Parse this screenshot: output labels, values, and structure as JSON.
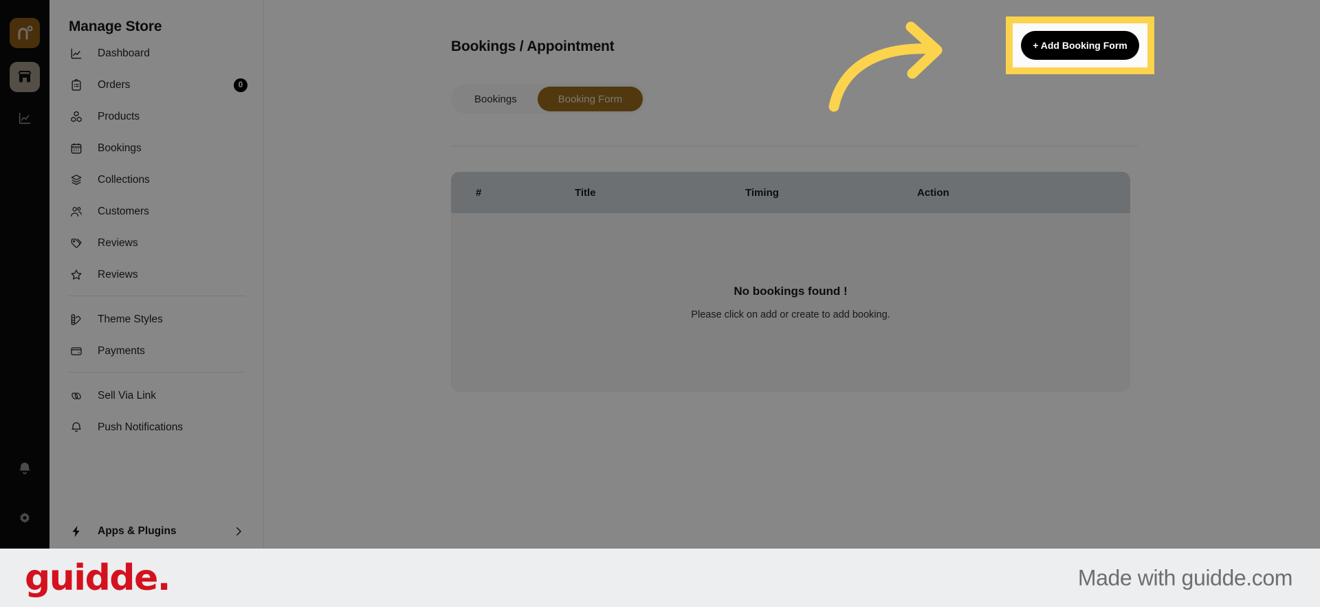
{
  "app": {
    "rail": {
      "logo_icon": "nuvemshop-n-logo-icon",
      "items": [
        {
          "icon": "store-icon",
          "name": "store",
          "active": true
        },
        {
          "icon": "analytics-chart-icon",
          "name": "analytics",
          "active": false
        },
        {
          "icon": "bell-icon",
          "name": "notifications",
          "active": false
        },
        {
          "icon": "gear-icon",
          "name": "settings",
          "active": false
        }
      ]
    },
    "sidebar": {
      "title": "Manage Store",
      "items": [
        {
          "label": "Dashboard",
          "icon": "chart-line-icon",
          "badge": null
        },
        {
          "label": "Orders",
          "icon": "clipboard-list-icon",
          "badge": "0"
        },
        {
          "label": "Products",
          "icon": "boxes-cubes-icon",
          "badge": null
        },
        {
          "label": "Bookings",
          "icon": "calendar-icon",
          "badge": null
        },
        {
          "label": "Collections",
          "icon": "layers-icon",
          "badge": null
        },
        {
          "label": "Customers",
          "icon": "users-icon",
          "badge": null
        },
        {
          "label": "Reviews",
          "icon": "star-icon",
          "badge": null
        },
        {
          "label": "Theme Styles",
          "icon": "palette-swatch-icon",
          "badge": null
        },
        {
          "label": "Payments",
          "icon": "wallet-icon",
          "badge": null
        },
        {
          "label": "Sell Via Link",
          "icon": "link-chain-icon",
          "badge": null
        },
        {
          "label": "Push Notifications",
          "icon": "bell-outline-icon",
          "badge": null
        }
      ],
      "footer": {
        "label": "Apps & Plugins",
        "icon": "lightning-bolt-icon",
        "chevron": "chevron-right-icon"
      }
    },
    "main": {
      "page_title": "Bookings / Appointment",
      "tabs": [
        {
          "label": "Bookings",
          "active": false
        },
        {
          "label": "Booking Form",
          "active": true
        }
      ],
      "cta": {
        "label": "+ Add Booking Form",
        "highlight_color": "#fcd34d",
        "background": "#000000"
      },
      "table": {
        "columns": [
          "#",
          "Title",
          "Timing",
          "Action"
        ],
        "rows": [],
        "empty_title": "No bookings found !",
        "empty_subtitle": "Please click on add or create to add booking."
      }
    },
    "footer": {
      "logo_text": "guidde.",
      "logo_color": "#d4111e",
      "made_with": "Made with guidde.com"
    },
    "annotation": {
      "arrow_color": "#fcd34d",
      "type": "curved-arrow-pointing-right"
    }
  }
}
